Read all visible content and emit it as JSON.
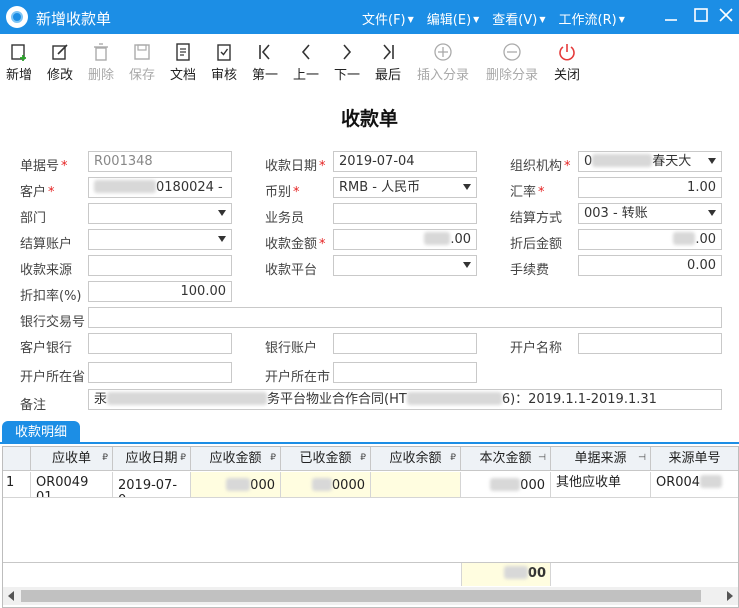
{
  "window": {
    "title": "新增收款单",
    "menus": [
      "文件(F)",
      "编辑(E)",
      "查看(V)",
      "工作流(R)"
    ]
  },
  "toolbar": [
    {
      "label": "新增",
      "icon": "add-doc-icon",
      "disabled": false
    },
    {
      "label": "修改",
      "icon": "edit-icon",
      "disabled": false
    },
    {
      "label": "删除",
      "icon": "trash-icon",
      "disabled": true
    },
    {
      "label": "保存",
      "icon": "save-icon",
      "disabled": true
    },
    {
      "label": "文档",
      "icon": "document-icon",
      "disabled": false
    },
    {
      "label": "审核",
      "icon": "approve-icon",
      "disabled": false
    },
    {
      "label": "第一",
      "icon": "first-icon",
      "disabled": false
    },
    {
      "label": "上一",
      "icon": "prev-icon",
      "disabled": false
    },
    {
      "label": "下一",
      "icon": "next-icon",
      "disabled": false
    },
    {
      "label": "最后",
      "icon": "last-icon",
      "disabled": false
    },
    {
      "label": "插入分录",
      "icon": "insert-row-icon",
      "disabled": true
    },
    {
      "label": "删除分录",
      "icon": "delete-row-icon",
      "disabled": true
    },
    {
      "label": "关闭",
      "icon": "power-icon",
      "disabled": false
    }
  ],
  "form": {
    "title": "收款单",
    "doc_no": {
      "label": "单据号",
      "value": "R001348"
    },
    "date": {
      "label": "收款日期",
      "value": "2019-07-04"
    },
    "org": {
      "label": "组织机构",
      "value_prefix": "0",
      "value_suffix": "春天大"
    },
    "customer": {
      "label": "客户",
      "value": "0180024 -"
    },
    "currency": {
      "label": "币别",
      "value": "RMB - 人民币"
    },
    "rate": {
      "label": "汇率",
      "value": "1.00"
    },
    "dept": {
      "label": "部门",
      "value": ""
    },
    "salesman": {
      "label": "业务员",
      "value": ""
    },
    "settle_method": {
      "label": "结算方式",
      "value": "003 - 转账"
    },
    "settle_account": {
      "label": "结算账户",
      "value": ""
    },
    "amount": {
      "label": "收款金额",
      "value": ".00"
    },
    "discounted_amount": {
      "label": "折后金额",
      "value": ".00"
    },
    "source": {
      "label": "收款来源",
      "value": ""
    },
    "platform": {
      "label": "收款平台",
      "value": ""
    },
    "fee": {
      "label": "手续费",
      "value": "0.00"
    },
    "discount_rate": {
      "label": "折扣率(%)",
      "value": "100.00"
    },
    "bank_txn_no": {
      "label": "银行交易号",
      "value": ""
    },
    "customer_bank": {
      "label": "客户银行",
      "value": ""
    },
    "bank_account": {
      "label": "银行账户",
      "value": ""
    },
    "account_name": {
      "label": "开户名称",
      "value": ""
    },
    "province": {
      "label": "开户所在省",
      "value": ""
    },
    "city": {
      "label": "开户所在市",
      "value": ""
    },
    "remark": {
      "label": "备注",
      "value_prefix": "汞",
      "value_mid": "务平台物业合作合同(HT",
      "value_suffix": "6)：2019.1.1-2019.1.31"
    }
  },
  "detail_tab": {
    "label": "收款明细"
  },
  "grid": {
    "columns": [
      "应收单",
      "应收日期",
      "应收金额",
      "已收金额",
      "应收余额",
      "本次金额",
      "单据来源",
      "来源单号"
    ],
    "rows": [
      {
        "index": "1",
        "ar_no": "OR0049 01",
        "ar_date": "2019-07-0",
        "ar_amount": "000",
        "received": "0000",
        "balance": "",
        "current": "000",
        "source": "其他应收单",
        "source_no": "OR004"
      }
    ],
    "total_current": "00"
  }
}
